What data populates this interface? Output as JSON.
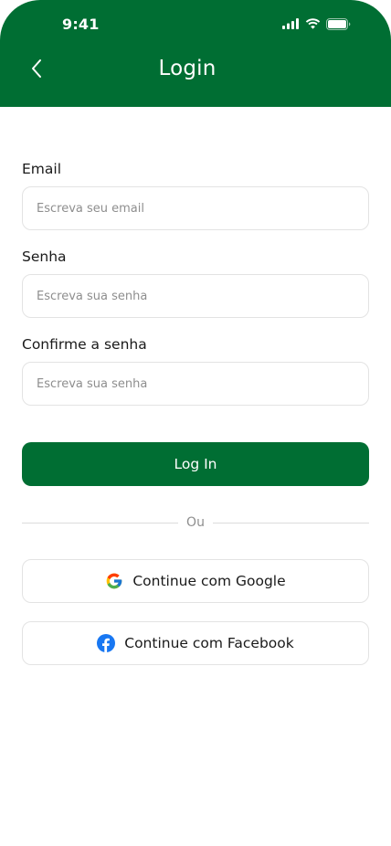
{
  "status_bar": {
    "time": "9:41",
    "icons": [
      "signal-icon",
      "wifi-icon",
      "battery-icon"
    ]
  },
  "header": {
    "title": "Login",
    "back_icon": "chevron-left-icon",
    "background_color": "#006e33"
  },
  "form": {
    "email": {
      "label": "Email",
      "value": "",
      "placeholder": "Escreva seu email"
    },
    "password": {
      "label": "Senha",
      "value": "",
      "placeholder": "Escreva sua senha"
    },
    "confirm_password": {
      "label": "Confirme a senha",
      "value": "",
      "placeholder": "Escreva sua senha"
    },
    "submit_label": "Log In"
  },
  "divider": {
    "label": "Ou"
  },
  "social": {
    "google": {
      "label": "Continue com Google",
      "icon": "google-icon"
    },
    "facebook": {
      "label": "Continue com Facebook",
      "icon": "facebook-icon"
    }
  },
  "colors": {
    "primary": "#006e33",
    "border": "#e3e3e3",
    "placeholder": "#8e8e8e",
    "facebook": "#1877f2"
  }
}
